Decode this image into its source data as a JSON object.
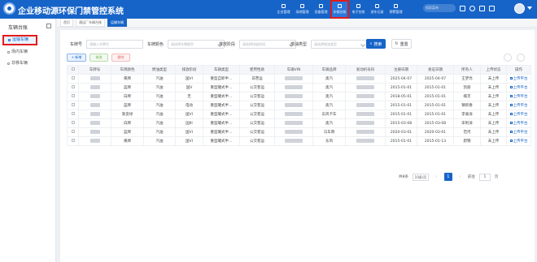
{
  "app": {
    "title": "企业移动源环保门禁管控系统"
  },
  "nav": {
    "items": [
      {
        "label": "企业管理"
      },
      {
        "label": "场地管理"
      },
      {
        "label": "设备管理"
      },
      {
        "label": "车辆台账"
      },
      {
        "label": "电子台账"
      },
      {
        "label": "进车记录"
      },
      {
        "label": "预警管理"
      }
    ],
    "search_placeholder": "搜索菜单"
  },
  "sidebar": {
    "title": "车辆台账",
    "items": [
      {
        "label": "运输车辆"
      },
      {
        "label": "场内车辆"
      },
      {
        "label": "非移车辆"
      }
    ]
  },
  "tabs": [
    {
      "label": "首页"
    },
    {
      "label": "通运厂车辆台账"
    },
    {
      "label": "运输车辆"
    }
  ],
  "filters": {
    "plate_label": "车牌号",
    "plate_placeholder": "请输入车牌号",
    "color_label": "车牌颜色",
    "color_placeholder": "请选择车牌颜色",
    "stage_label": "排放阶段",
    "stage_placeholder": "请选择排放阶段",
    "fuel_label": "燃油类型",
    "fuel_placeholder": "请选择燃油类型",
    "search_button": "搜索",
    "reset_button": "重置"
  },
  "toolbar": {
    "add": "+ 新增",
    "edit": "修改",
    "delete": "删除"
  },
  "table": {
    "headers": [
      "车牌号",
      "车牌颜色",
      "燃油类型",
      "排放阶段",
      "车辆类型",
      "使用性质",
      "车辆VIN",
      "车辆品牌",
      "发动机号码",
      "注册日期",
      "发证日期",
      "所有人",
      "上传状态",
      "操作"
    ],
    "rows": [
      {
        "color": "黄牌",
        "fuel": "汽油",
        "stage": "国VI",
        "type": "重型自卸半…",
        "use": "非营运",
        "brand": "奥汽",
        "reg": "2025-04-07",
        "issue": "2025-04-07",
        "owner": "王梦亮",
        "status": "未上传",
        "op": "上传平台"
      },
      {
        "color": "蓝牌",
        "fuel": "汽油",
        "stage": "国V",
        "type": "重型罐式半…",
        "use": "公交客运",
        "brand": "奥汽",
        "reg": "2015-01-01",
        "issue": "2015-01-01",
        "owner": "凯丽",
        "status": "未上传",
        "op": "上传平台"
      },
      {
        "color": "白牌",
        "fuel": "汽油",
        "stage": "无",
        "type": "重型罐式半…",
        "use": "公交客运",
        "brand": "奥汽",
        "reg": "2018-05-01",
        "issue": "2015-01-01",
        "owner": "楠丰",
        "status": "未上传",
        "op": "上传平台"
      },
      {
        "color": "蓝牌",
        "fuel": "汽油",
        "stage": "电动",
        "type": "重型罐式半…",
        "use": "公交客运",
        "brand": "奥汽",
        "reg": "2015-01-01",
        "issue": "2015-01-01",
        "owner": "镇新春",
        "status": "未上传",
        "op": "上传平台"
      },
      {
        "color": "渐变绿",
        "fuel": "汽油",
        "stage": "国VI",
        "type": "重型罐式半…",
        "use": "公交客运",
        "brand": "东风卡车",
        "reg": "2015-01-01",
        "issue": "2015-01-01",
        "owner": "李毫涛",
        "status": "未上传",
        "op": "上传平台"
      },
      {
        "color": "白牌",
        "fuel": "汽油",
        "stage": "国III",
        "type": "重型罐式半…",
        "use": "公交客运",
        "brand": "奥汽",
        "reg": "2015-03-08",
        "issue": "2015-03-08",
        "owner": "宋利涛",
        "status": "未上传",
        "op": "上传平台"
      },
      {
        "color": "蓝牌",
        "fuel": "汽油",
        "stage": "国VI",
        "type": "重型罐式半…",
        "use": "公交客运",
        "brand": "马车牌",
        "reg": "2020-03-01",
        "issue": "2020-03-01",
        "owner": "范河",
        "status": "未上传",
        "op": "上传平台"
      },
      {
        "color": "黄牌",
        "fuel": "汽油",
        "stage": "国VI",
        "type": "重型罐式半…",
        "use": "公交客运",
        "brand": "东风",
        "reg": "2015-01-01",
        "issue": "2015-01-13",
        "owner": "蔚锦",
        "status": "未上传",
        "op": "上传平台"
      }
    ]
  },
  "pager": {
    "total": "共8条",
    "size": "10条/页",
    "page": "1",
    "goto": "前往",
    "goto_value": "1",
    "page_unit": "页"
  }
}
